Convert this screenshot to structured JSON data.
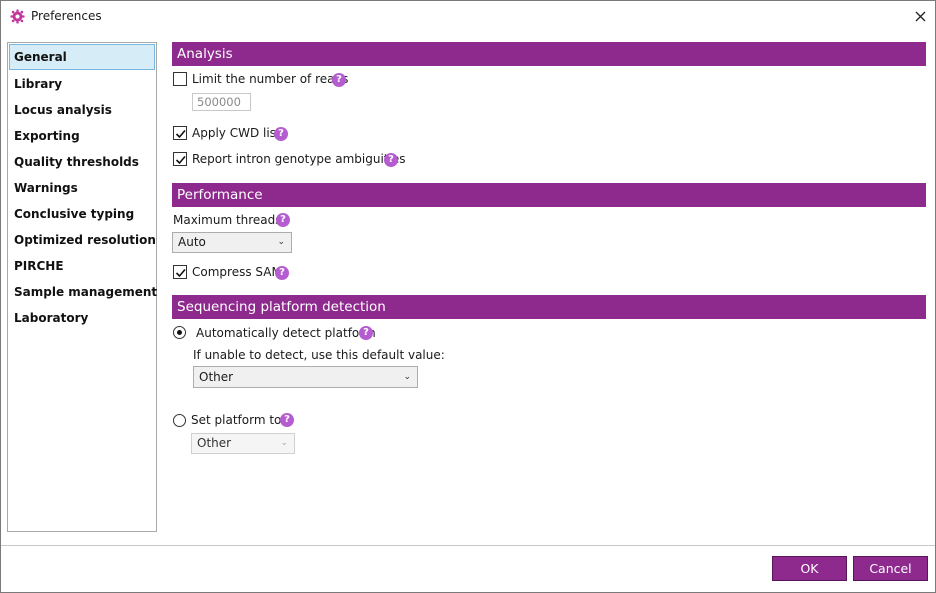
{
  "window": {
    "title": "Preferences"
  },
  "colors": {
    "accent": "#8e2a8e",
    "help_icon": "#b55dd0",
    "selected_nav": "#d6ecf7"
  },
  "sidebar": {
    "items": [
      {
        "label": "General",
        "selected": true
      },
      {
        "label": "Library"
      },
      {
        "label": "Locus analysis"
      },
      {
        "label": "Exporting"
      },
      {
        "label": "Quality thresholds"
      },
      {
        "label": "Warnings"
      },
      {
        "label": "Conclusive typing"
      },
      {
        "label": "Optimized resolution"
      },
      {
        "label": "PIRCHE"
      },
      {
        "label": "Sample management"
      },
      {
        "label": "Laboratory"
      }
    ]
  },
  "analysis": {
    "header": "Analysis",
    "limit_reads": {
      "label": "Limit the number of reads",
      "checked": false
    },
    "reads_value": "500000",
    "apply_cwd": {
      "label": "Apply CWD list",
      "checked": true
    },
    "report_intron": {
      "label": "Report intron genotype ambiguities",
      "checked": true
    }
  },
  "performance": {
    "header": "Performance",
    "threads_label": "Maximum threads",
    "threads_value": "Auto",
    "compress_sam": {
      "label": "Compress SAM",
      "checked": true
    }
  },
  "platform": {
    "header": "Sequencing platform detection",
    "auto_detect": {
      "label": "Automatically detect platform",
      "selected": true
    },
    "default_label": "If unable to detect, use this default value:",
    "default_value": "Other",
    "set_platform": {
      "label": "Set platform to",
      "selected": false
    },
    "set_value": "Other"
  },
  "footer": {
    "ok_label": "OK",
    "cancel_label": "Cancel"
  }
}
